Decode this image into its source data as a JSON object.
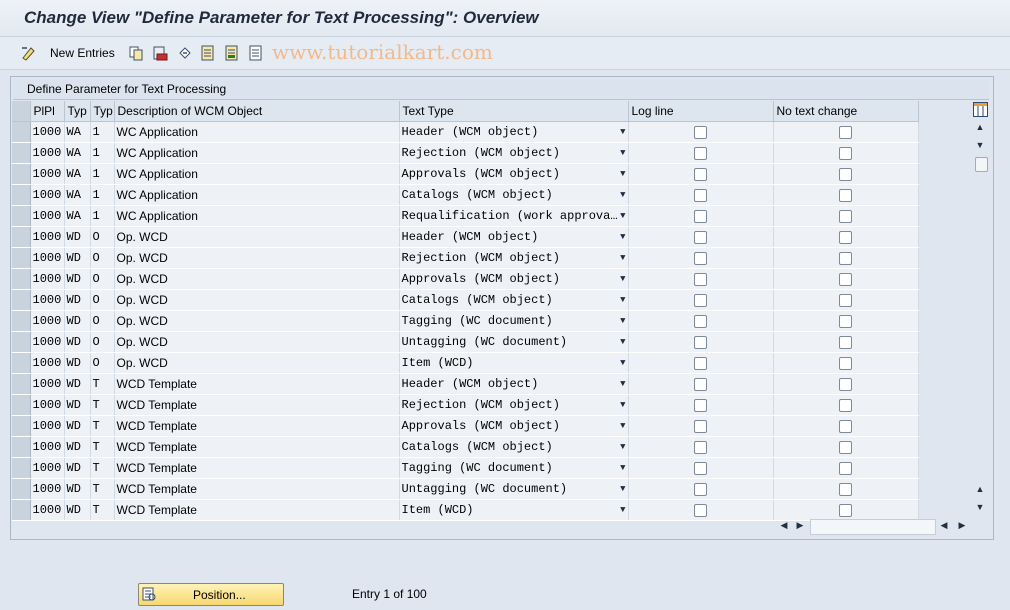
{
  "window": {
    "title": "Change View \"Define Parameter for Text Processing\": Overview"
  },
  "toolbar": {
    "new_entries_label": "New Entries",
    "icons": [
      "display-change-icon",
      "copy-icon",
      "delete-icon",
      "undo-icon",
      "select-all-icon",
      "select-block-icon",
      "deselect-all-icon"
    ]
  },
  "watermark": "www.tutorialkart.com",
  "panel": {
    "title": "Define Parameter for Text Processing"
  },
  "table": {
    "headers": [
      "PlPl",
      "Typ",
      "Typ",
      "Description of WCM Object",
      "Text Type",
      "Log line",
      "No text change"
    ],
    "rows": [
      {
        "plpl": "1000",
        "typ1": "WA",
        "typ2": "1",
        "desc": "WC Application",
        "text_type": "Header (WCM object)"
      },
      {
        "plpl": "1000",
        "typ1": "WA",
        "typ2": "1",
        "desc": "WC Application",
        "text_type": "Rejection (WCM object)"
      },
      {
        "plpl": "1000",
        "typ1": "WA",
        "typ2": "1",
        "desc": "WC Application",
        "text_type": "Approvals (WCM object)"
      },
      {
        "plpl": "1000",
        "typ1": "WA",
        "typ2": "1",
        "desc": "WC Application",
        "text_type": "Catalogs (WCM object)"
      },
      {
        "plpl": "1000",
        "typ1": "WA",
        "typ2": "1",
        "desc": "WC Application",
        "text_type": "Requalification (work approva…"
      },
      {
        "plpl": "1000",
        "typ1": "WD",
        "typ2": "O",
        "desc": "Op. WCD",
        "text_type": "Header (WCM object)"
      },
      {
        "plpl": "1000",
        "typ1": "WD",
        "typ2": "O",
        "desc": "Op. WCD",
        "text_type": "Rejection (WCM object)"
      },
      {
        "plpl": "1000",
        "typ1": "WD",
        "typ2": "O",
        "desc": "Op. WCD",
        "text_type": "Approvals (WCM object)"
      },
      {
        "plpl": "1000",
        "typ1": "WD",
        "typ2": "O",
        "desc": "Op. WCD",
        "text_type": "Catalogs (WCM object)"
      },
      {
        "plpl": "1000",
        "typ1": "WD",
        "typ2": "O",
        "desc": "Op. WCD",
        "text_type": "Tagging (WC document)"
      },
      {
        "plpl": "1000",
        "typ1": "WD",
        "typ2": "O",
        "desc": "Op. WCD",
        "text_type": "Untagging (WC document)"
      },
      {
        "plpl": "1000",
        "typ1": "WD",
        "typ2": "O",
        "desc": "Op. WCD",
        "text_type": "Item (WCD)"
      },
      {
        "plpl": "1000",
        "typ1": "WD",
        "typ2": "T",
        "desc": "WCD Template",
        "text_type": "Header (WCM object)"
      },
      {
        "plpl": "1000",
        "typ1": "WD",
        "typ2": "T",
        "desc": "WCD Template",
        "text_type": "Rejection (WCM object)"
      },
      {
        "plpl": "1000",
        "typ1": "WD",
        "typ2": "T",
        "desc": "WCD Template",
        "text_type": "Approvals (WCM object)"
      },
      {
        "plpl": "1000",
        "typ1": "WD",
        "typ2": "T",
        "desc": "WCD Template",
        "text_type": "Catalogs (WCM object)"
      },
      {
        "plpl": "1000",
        "typ1": "WD",
        "typ2": "T",
        "desc": "WCD Template",
        "text_type": "Tagging (WC document)"
      },
      {
        "plpl": "1000",
        "typ1": "WD",
        "typ2": "T",
        "desc": "WCD Template",
        "text_type": "Untagging (WC document)"
      },
      {
        "plpl": "1000",
        "typ1": "WD",
        "typ2": "T",
        "desc": "WCD Template",
        "text_type": "Item (WCD)"
      }
    ]
  },
  "footer": {
    "position_label": "Position...",
    "entry_text": "Entry 1 of 100"
  },
  "colors": {
    "background": "#dfe6ef",
    "button": "#f7d870",
    "watermark": "#f3b98a"
  }
}
